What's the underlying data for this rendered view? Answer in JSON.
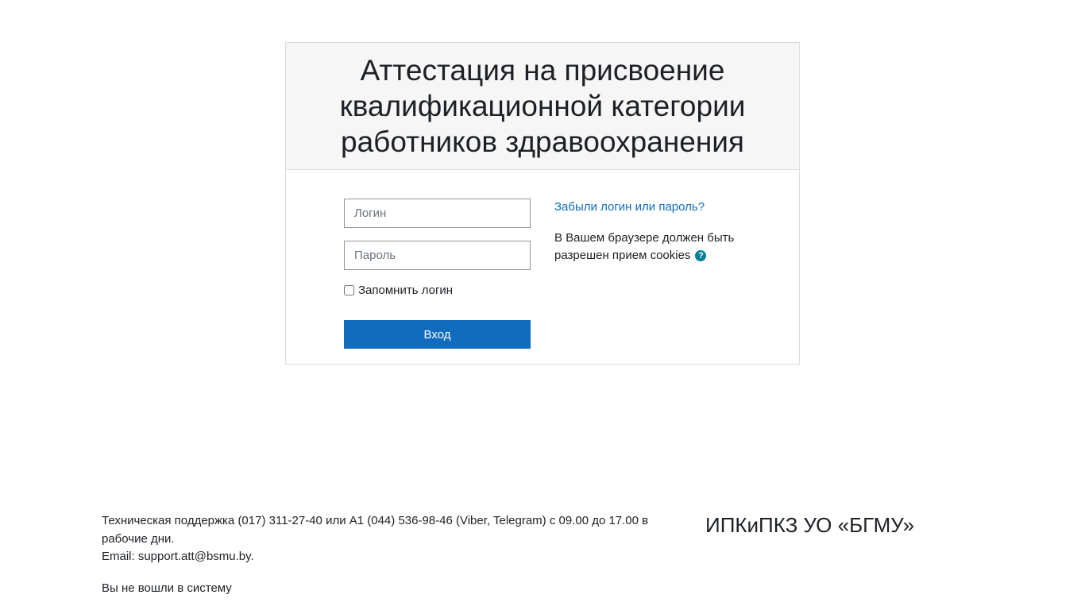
{
  "login_card": {
    "title": "Аттестация на присвоение квалификационной категории работников здравоохранения",
    "username_placeholder": "Логин",
    "password_placeholder": "Пароль",
    "remember_label": "Запомнить логин",
    "remember_checked": false,
    "submit_label": "Вход",
    "forgot_link": "Забыли логин или пароль?",
    "cookies_notice": "В Вашем браузере должен быть разрешен прием cookies",
    "help_icon": "question-circle-icon"
  },
  "footer": {
    "support_text": "Техническая поддержка (017) 311-27-40 или А1 (044) 536-98-46 (Viber, Telegram) с 09.00 до 17.00 в рабочие дни.",
    "email_text": "Email: support.att@bsmu.by.",
    "login_status": "Вы не вошли в систему",
    "organization": "ИПКиПКЗ УО «БГМУ»"
  },
  "colors": {
    "primary": "#0f6cbf",
    "help_icon": "#008196",
    "header_bg": "#f6f6f6"
  }
}
